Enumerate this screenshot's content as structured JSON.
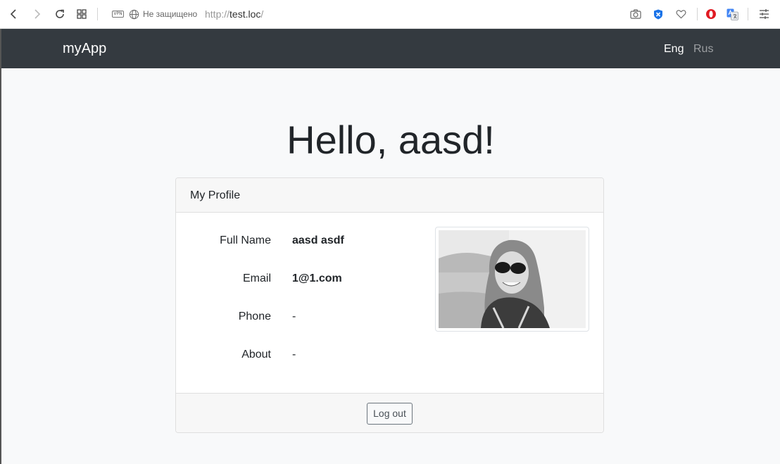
{
  "browser": {
    "vpn_label": "VPN",
    "security_text": "Не защищено",
    "url": {
      "protocol": "http://",
      "host": "test.loc",
      "path": "/"
    }
  },
  "navbar": {
    "brand": "myApp",
    "languages": [
      {
        "label": "Eng",
        "active": true
      },
      {
        "label": "Rus",
        "active": false
      }
    ],
    "background": "#343a40"
  },
  "page": {
    "greeting": "Hello, aasd!",
    "profile": {
      "title": "My Profile",
      "fields": [
        {
          "label": "Full Name",
          "value": "aasd asdf"
        },
        {
          "label": "Email",
          "value": "1@1.com"
        },
        {
          "label": "Phone",
          "value": "-"
        },
        {
          "label": "About",
          "value": "-"
        }
      ],
      "photo": "avatar-photo"
    },
    "logout_label": "Log out"
  },
  "icons": [
    "back-icon",
    "forward-icon",
    "reload-icon",
    "speed-dial-icon",
    "vpn-icon",
    "globe-icon",
    "camera-icon",
    "adblock-icon",
    "heart-icon",
    "opera-icon",
    "translate-icon",
    "easy-setup-icon"
  ]
}
